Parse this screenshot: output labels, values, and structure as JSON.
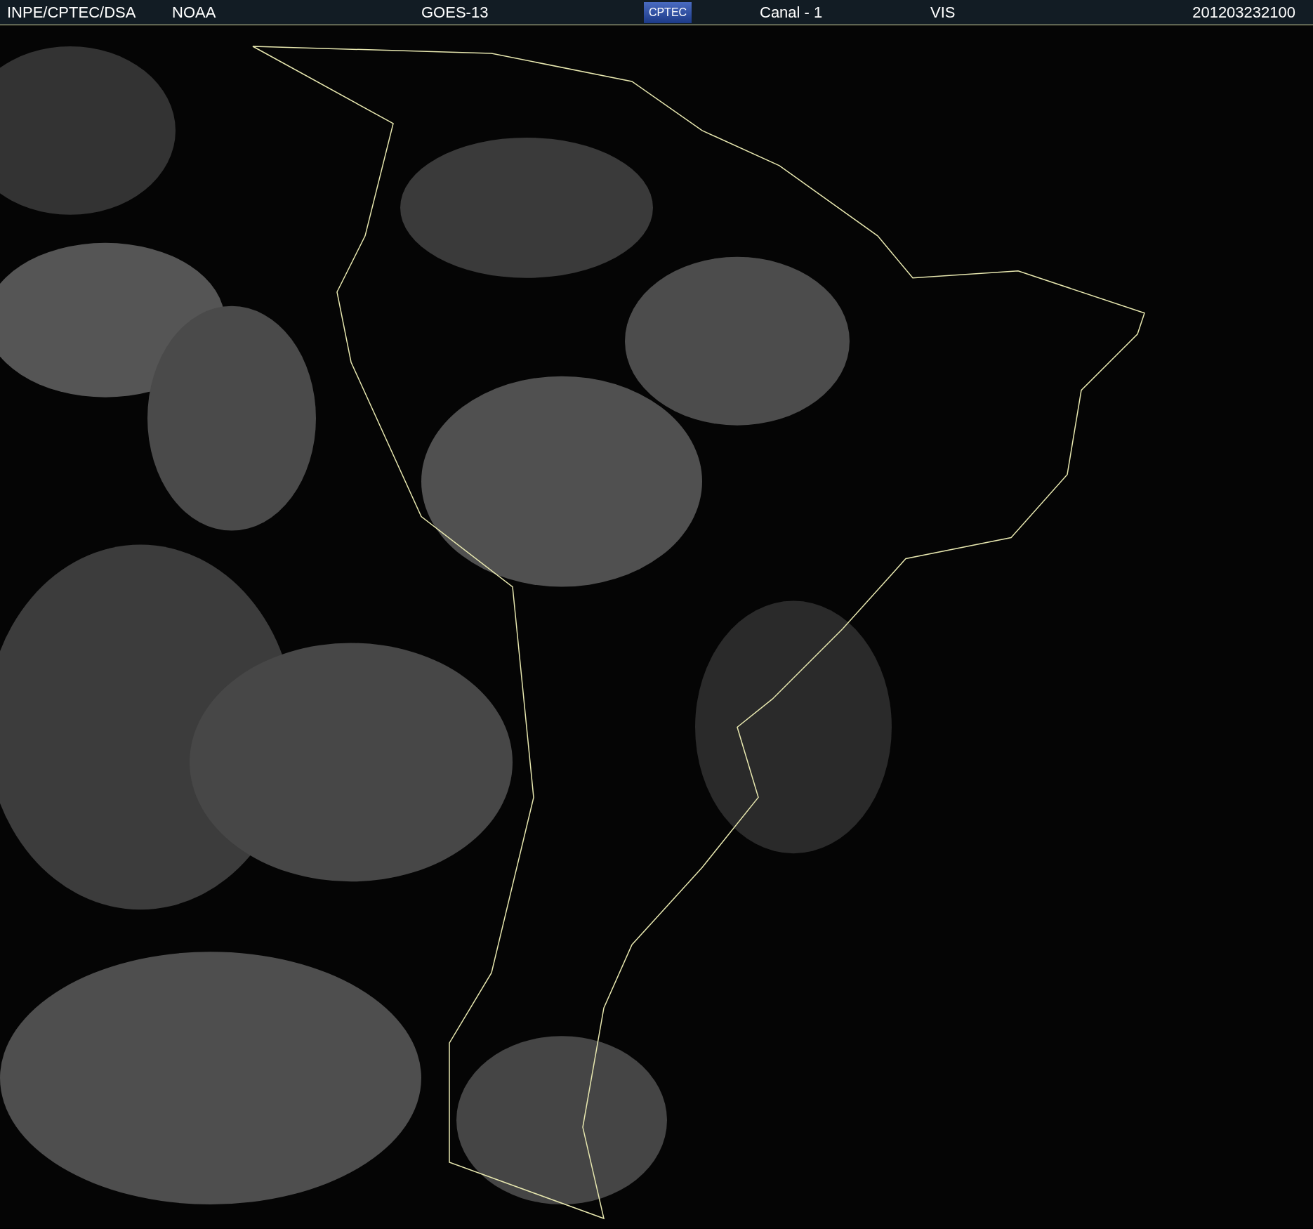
{
  "header": {
    "source": "INPE/CPTEC/DSA",
    "agency": "NOAA",
    "satellite": "GOES-13",
    "logo": "CPTEC",
    "channel": "Canal - 1",
    "band": "VIS",
    "timestamp": "201203232100"
  }
}
